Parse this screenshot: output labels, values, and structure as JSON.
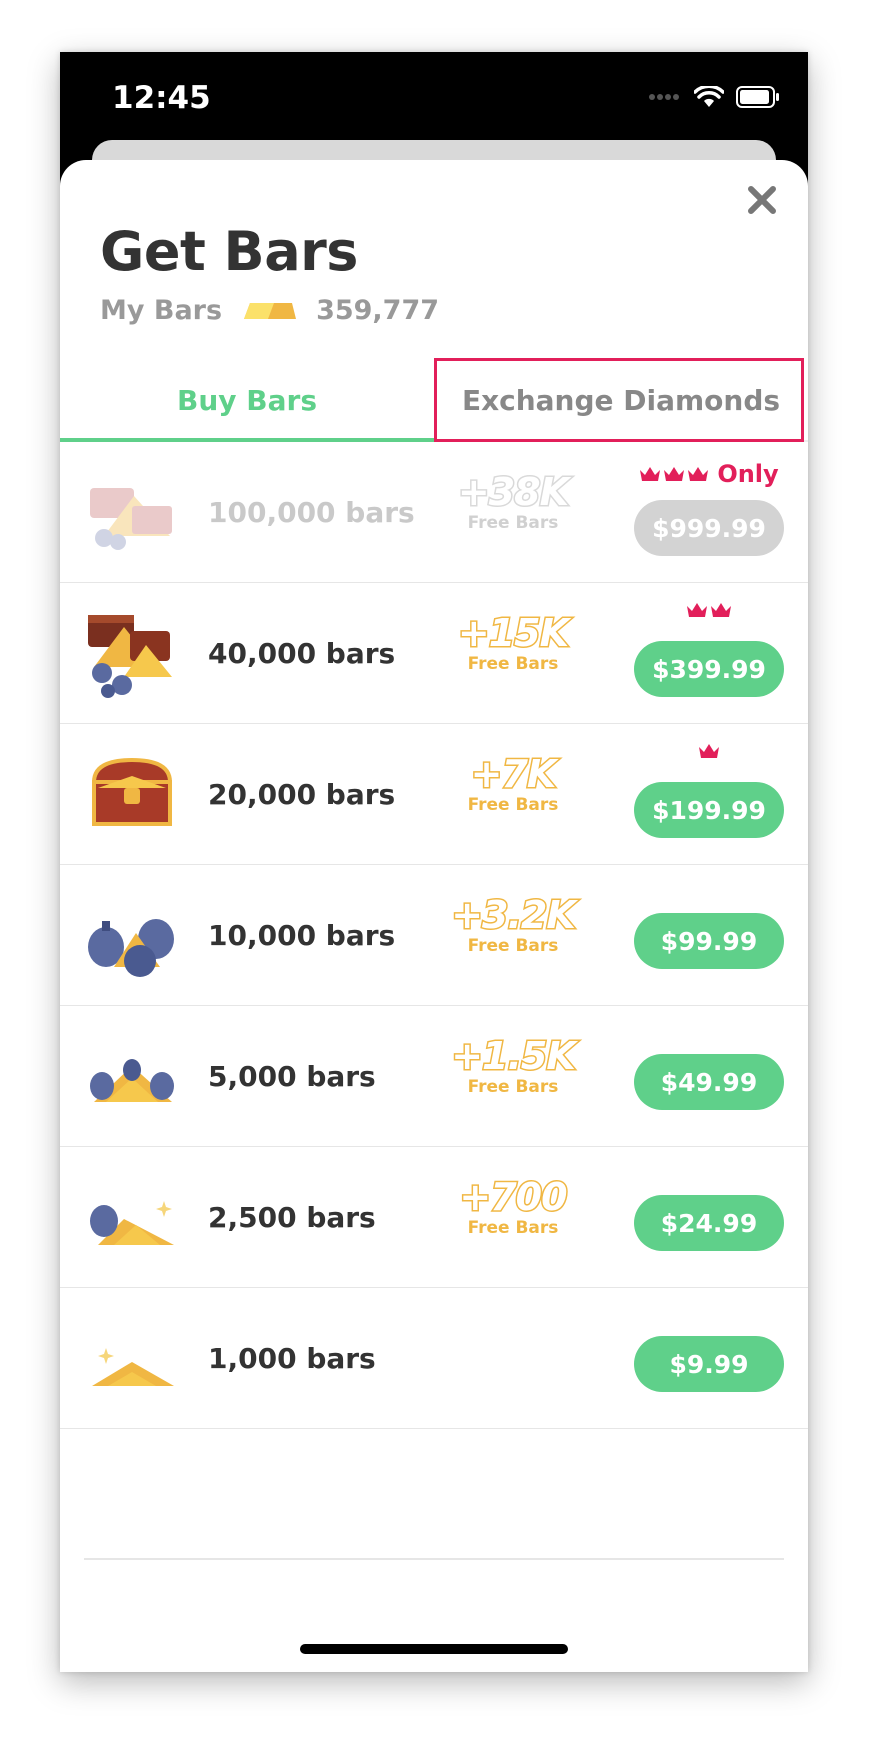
{
  "status_bar": {
    "time": "12:45"
  },
  "header": {
    "title": "Get Bars",
    "my_bars_label": "My Bars",
    "my_bars_value": "359,777"
  },
  "tabs": [
    {
      "label": "Buy Bars",
      "active": true
    },
    {
      "label": "Exchange Diamonds",
      "active": false
    }
  ],
  "products": [
    {
      "label": "100,000 bars",
      "bonus": "+38K",
      "bonus_sub": "Free Bars",
      "price": "$999.99",
      "crowns": 3,
      "tag": "Only",
      "icon": "treasure-pile-icon"
    },
    {
      "label": "40,000 bars",
      "bonus": "+15K",
      "bonus_sub": "Free Bars",
      "price": "$399.99",
      "crowns": 2,
      "icon": "chests-and-sacks-icon"
    },
    {
      "label": "20,000 bars",
      "bonus": "+7K",
      "bonus_sub": "Free Bars",
      "price": "$199.99",
      "crowns": 1,
      "icon": "treasure-chest-icon"
    },
    {
      "label": "10,000 bars",
      "bonus": "+3.2K",
      "bonus_sub": "Free Bars",
      "price": "$99.99",
      "icon": "money-sacks-icon"
    },
    {
      "label": "5,000 bars",
      "bonus": "+1.5K",
      "bonus_sub": "Free Bars",
      "price": "$49.99",
      "icon": "gold-pile-sacks-icon"
    },
    {
      "label": "2,500 bars",
      "bonus": "+700",
      "bonus_sub": "Free Bars",
      "price": "$24.99",
      "icon": "gold-bars-sack-icon"
    },
    {
      "label": "1,000 bars",
      "price": "$9.99",
      "icon": "gold-bars-icon"
    }
  ],
  "colors": {
    "accent": "#5fd08a",
    "gold": "#f0b743",
    "highlight": "#e21f5a",
    "title": "#333333"
  }
}
